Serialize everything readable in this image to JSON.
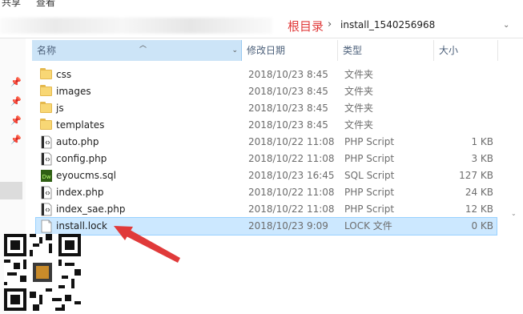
{
  "top_strip": {
    "left": "共享",
    "right": "查看"
  },
  "address_bar": {
    "root_label": "根目录",
    "separator": "›",
    "current_folder": "install_1540256968",
    "dropdown_glyph": "⌄"
  },
  "columns": {
    "name": "名称",
    "date": "修改日期",
    "type": "类型",
    "size": "大小"
  },
  "files": [
    {
      "name": "css",
      "date": "2018/10/23 8:45",
      "type": "文件夹",
      "size": "",
      "icon": "folder-icon"
    },
    {
      "name": "images",
      "date": "2018/10/23 8:45",
      "type": "文件夹",
      "size": "",
      "icon": "folder-icon"
    },
    {
      "name": "js",
      "date": "2018/10/23 8:45",
      "type": "文件夹",
      "size": "",
      "icon": "folder-icon"
    },
    {
      "name": "templates",
      "date": "2018/10/23 8:45",
      "type": "文件夹",
      "size": "",
      "icon": "folder-icon"
    },
    {
      "name": "auto.php",
      "date": "2018/10/22 11:08",
      "type": "PHP Script",
      "size": "1 KB",
      "icon": "php-file-icon"
    },
    {
      "name": "config.php",
      "date": "2018/10/22 11:08",
      "type": "PHP Script",
      "size": "3 KB",
      "icon": "php-file-icon"
    },
    {
      "name": "eyoucms.sql",
      "date": "2018/10/23 16:45",
      "type": "SQL Script",
      "size": "127 KB",
      "icon": "sql-file-icon"
    },
    {
      "name": "index.php",
      "date": "2018/10/22 11:08",
      "type": "PHP Script",
      "size": "24 KB",
      "icon": "php-file-icon"
    },
    {
      "name": "index_sae.php",
      "date": "2018/10/22 11:08",
      "type": "PHP Script",
      "size": "12 KB",
      "icon": "php-file-icon"
    },
    {
      "name": "install.lock",
      "date": "2018/10/23 9:09",
      "type": "LOCK 文件",
      "size": "0 KB",
      "icon": "lock-file-icon",
      "selected": true
    }
  ],
  "colors": {
    "selection_bg": "#cce8ff",
    "header_sorted_bg": "#cce4f7",
    "annotation_red": "#e03a3a",
    "folder_yellow": "#f8d775",
    "dreamweaver_green": "#2f5f14"
  }
}
